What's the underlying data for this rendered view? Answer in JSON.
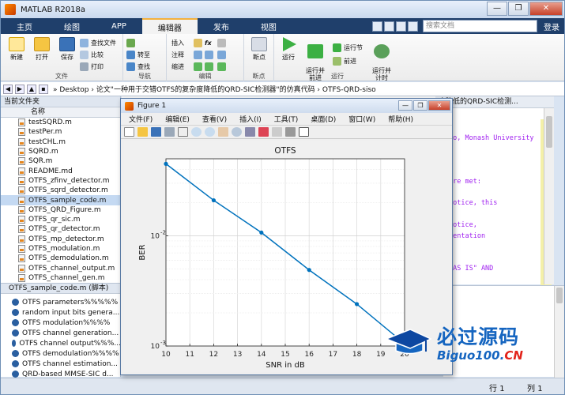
{
  "app": {
    "title": "MATLAB R2018a",
    "window_buttons": [
      "—",
      "❐",
      "✕"
    ]
  },
  "tabs": [
    "主页",
    "绘图",
    "APP",
    "编辑器",
    "发布",
    "视图"
  ],
  "active_tab": "编辑器",
  "search": {
    "placeholder": "搜索文档"
  },
  "login_label": "登录",
  "ribbon": {
    "file_group": {
      "label": "文件",
      "new": "新建",
      "open": "打开",
      "save": "保存",
      "find_files": "查找文件",
      "compare": "比较",
      "print": "打印"
    },
    "nav_group": {
      "label": "导航",
      "goto": "转至",
      "find": "查找"
    },
    "edit_group": {
      "label": "编辑",
      "insert": "插入",
      "comment": "注释",
      "indent": "缩进",
      "fx": "fx"
    },
    "breakpoint_group": {
      "label": "断点",
      "breakpoints": "断点"
    },
    "run_group": {
      "label": "运行",
      "run": "运行",
      "run_advance": "运行并\n前进",
      "run_section": "运行节",
      "advance": "前进",
      "run_time": "运行并\n计时"
    }
  },
  "address": {
    "path": "» Desktop › 论文\"一种用于交错OTFS的复杂度降低的QRD-SIC检测器\"的仿真代码 › OTFS-QRD-siso"
  },
  "left_panel": {
    "header": "当前文件夹",
    "column_name": "名称",
    "files": [
      "testSQRD.m",
      "testPer.m",
      "testCHL.m",
      "SQRD.m",
      "SQR.m",
      "README.md",
      "OTFS_zfinv_detector.m",
      "OTFS_sqrd_detector.m",
      "OTFS_sample_code.m",
      "OTFS_QRD_Figure.m",
      "OTFS_qr_sic.m",
      "OTFS_qr_detector.m",
      "OTFS_mp_detector.m",
      "OTFS_modulation.m",
      "OTFS_demodulation.m",
      "OTFS_channel_output.m",
      "OTFS_channel_gen.m"
    ],
    "selected_file": "OTFS_sample_code.m",
    "detail_header": "OTFS_sample_code.m (脚本)",
    "sections": [
      "OTFS parameters%%%%%",
      "random input bits genera...",
      "OTFS modulation%%%%",
      "OTFS channel generation...",
      "OTFS channel output%%%...",
      "OTFS demodulation%%%%",
      "OTFS channel estimation...",
      "QRD-based MMSE-SIC d..."
    ]
  },
  "editor": {
    "tab_label": "度降低的QRD-SIC检测...",
    "code_lines": [
      "bo, Monash University",
      "are met:",
      "notice, this",
      "notice,",
      "mentation",
      "\"AS IS\" AND"
    ]
  },
  "status": {
    "row_label": "行",
    "row_value": "1",
    "col_label": "列",
    "col_value": "1"
  },
  "figure": {
    "window_title": "Figure 1",
    "menu": [
      "文件(F)",
      "编辑(E)",
      "查看(V)",
      "插入(I)",
      "工具(T)",
      "桌面(D)",
      "窗口(W)",
      "帮助(H)"
    ]
  },
  "chart_data": {
    "type": "line",
    "title": "OTFS",
    "xlabel": "SNR in dB",
    "ylabel": "BER",
    "x": [
      10,
      12,
      14,
      16,
      18,
      20
    ],
    "series": [
      {
        "values": [
          0.045,
          0.021,
          0.0107,
          0.0049,
          0.0024,
          0.00105
        ]
      }
    ],
    "xlim": [
      10,
      20
    ],
    "ylim": [
      0.001,
      0.05
    ],
    "yscale": "log",
    "xticks": [
      "10",
      "11",
      "12",
      "13",
      "14",
      "15",
      "16",
      "17",
      "18",
      "19",
      "20"
    ],
    "yticks": [
      "10^-3",
      "10^-2"
    ],
    "grid": true,
    "line_color": "#0072BD"
  },
  "watermark": {
    "brand": "必过源码",
    "domain_main": "Biguo100.",
    "domain_cn": "CN"
  }
}
